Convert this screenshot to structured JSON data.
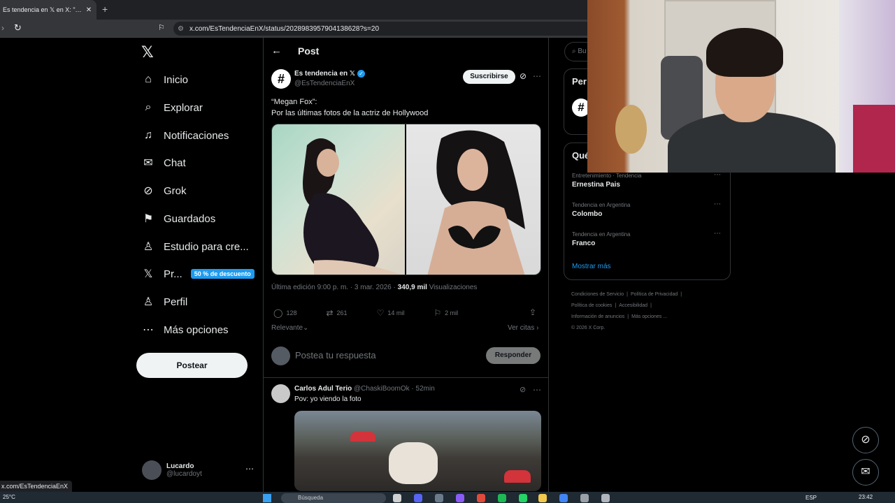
{
  "browser": {
    "tab_title": "Es tendencia en 𝕏 en X: \"Megan",
    "tab_close": "✕",
    "new_tab": "+",
    "url": "x.com/EsTendenciaEnX/status/2028983957904138628?s=20"
  },
  "nav": {
    "items": [
      {
        "label": "Inicio",
        "icon": "home-icon",
        "glyph": "⌂"
      },
      {
        "label": "Explorar",
        "icon": "search-icon",
        "glyph": "⌕"
      },
      {
        "label": "Notificaciones",
        "icon": "bell-icon",
        "glyph": "♫"
      },
      {
        "label": "Chat",
        "icon": "mail-icon",
        "glyph": "✉"
      },
      {
        "label": "Grok",
        "icon": "grok-icon",
        "glyph": "⊘"
      },
      {
        "label": "Guardados",
        "icon": "bookmark-icon",
        "glyph": "⚑"
      },
      {
        "label": "Estudio para cre...",
        "icon": "creator-studio-icon",
        "glyph": "♙"
      },
      {
        "label": "Pr...",
        "icon": "premium-icon",
        "glyph": "𝕏"
      },
      {
        "label": "Perfil",
        "icon": "profile-icon",
        "glyph": "♙"
      },
      {
        "label": "Más opciones",
        "icon": "more-options-icon",
        "glyph": "⋯"
      }
    ],
    "promo_badge": "50 % de descuento",
    "post_button": "Postear",
    "user": {
      "name": "Lucardo",
      "handle": "@lucardoyt"
    }
  },
  "post": {
    "header": "Post",
    "account_name": "Es tendencia en 𝕏",
    "account_handle": "@EsTendenciaEnX",
    "subscribe": "Suscribirse",
    "text_line1": "“Megan Fox”:",
    "text_line2": "Por las últimas fotos de la actriz de Hollywood",
    "edited": "Última edición 9:00 p. m. · 3 mar. 2026 ·",
    "views_count": "340,9 mil",
    "views_label": "Visualizaciones",
    "replies": "128",
    "reposts": "261",
    "likes": "14 mil",
    "bookmarks": "2 mil",
    "sort": "Relevante",
    "quotes": "Ver citas"
  },
  "reply_box": {
    "placeholder": "Postea tu respuesta",
    "button": "Responder"
  },
  "reply": {
    "name": "Carlos Adul Terio",
    "handle": "@ChaskiBoomOk · 52min",
    "text": "Pov: yo viendo la foto"
  },
  "sidebar": {
    "search_placeholder": "Bu",
    "box1_title": "Per",
    "box2_title": "Qué",
    "trends": [
      {
        "category": "Entretenimiento · Tendencia",
        "name": "Ernestina Pais"
      },
      {
        "category": "Tendencia en Argentina",
        "name": "Colombo"
      },
      {
        "category": "Tendencia en Argentina",
        "name": "Franco"
      }
    ],
    "show_more": "Mostrar más",
    "footer": [
      "Condiciones de Servicio",
      "|",
      "Política de Privacidad",
      "|",
      "Política de cookies",
      "|",
      "Accesibilidad",
      "|",
      "Información de anuncios",
      "|",
      "Más opciones ...",
      "© 2026 X Corp."
    ]
  },
  "status_url": "x.com/EsTendenciaEnX",
  "taskbar": {
    "temperature": "25°C",
    "search": "Búsqueda",
    "lang": "ESP",
    "time": "23:42"
  },
  "colors": {
    "accent": "#1d9bf0",
    "background": "#000000",
    "text": "#e7e9ea",
    "muted": "#71767b"
  }
}
